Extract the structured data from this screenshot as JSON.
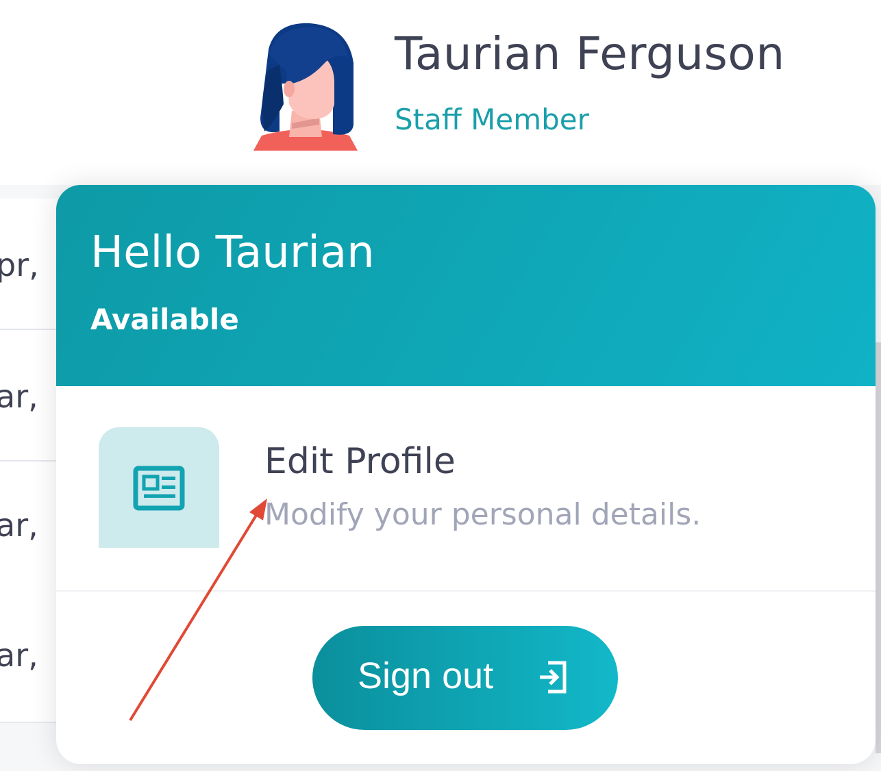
{
  "header": {
    "user_name": "Taurian Ferguson",
    "user_role": "Staff Member",
    "avatar_icon": "user-avatar-icon"
  },
  "background_table": {
    "rows": [
      "pr,",
      "ar,",
      "ar,",
      "ar,"
    ]
  },
  "dropdown": {
    "greeting": "Hello Taurian",
    "status": "Available",
    "menu_items": [
      {
        "title": "Edit Profile",
        "description": "Modify your personal details.",
        "icon": "id-card-icon"
      }
    ],
    "signout_label": "Sign out",
    "signout_icon": "sign-out-icon"
  },
  "colors": {
    "accent": "#10a9b8",
    "accent_dark": "#0b8f9c",
    "icon_bg": "#cdeaed",
    "annotation_arrow": "#e04a35"
  }
}
